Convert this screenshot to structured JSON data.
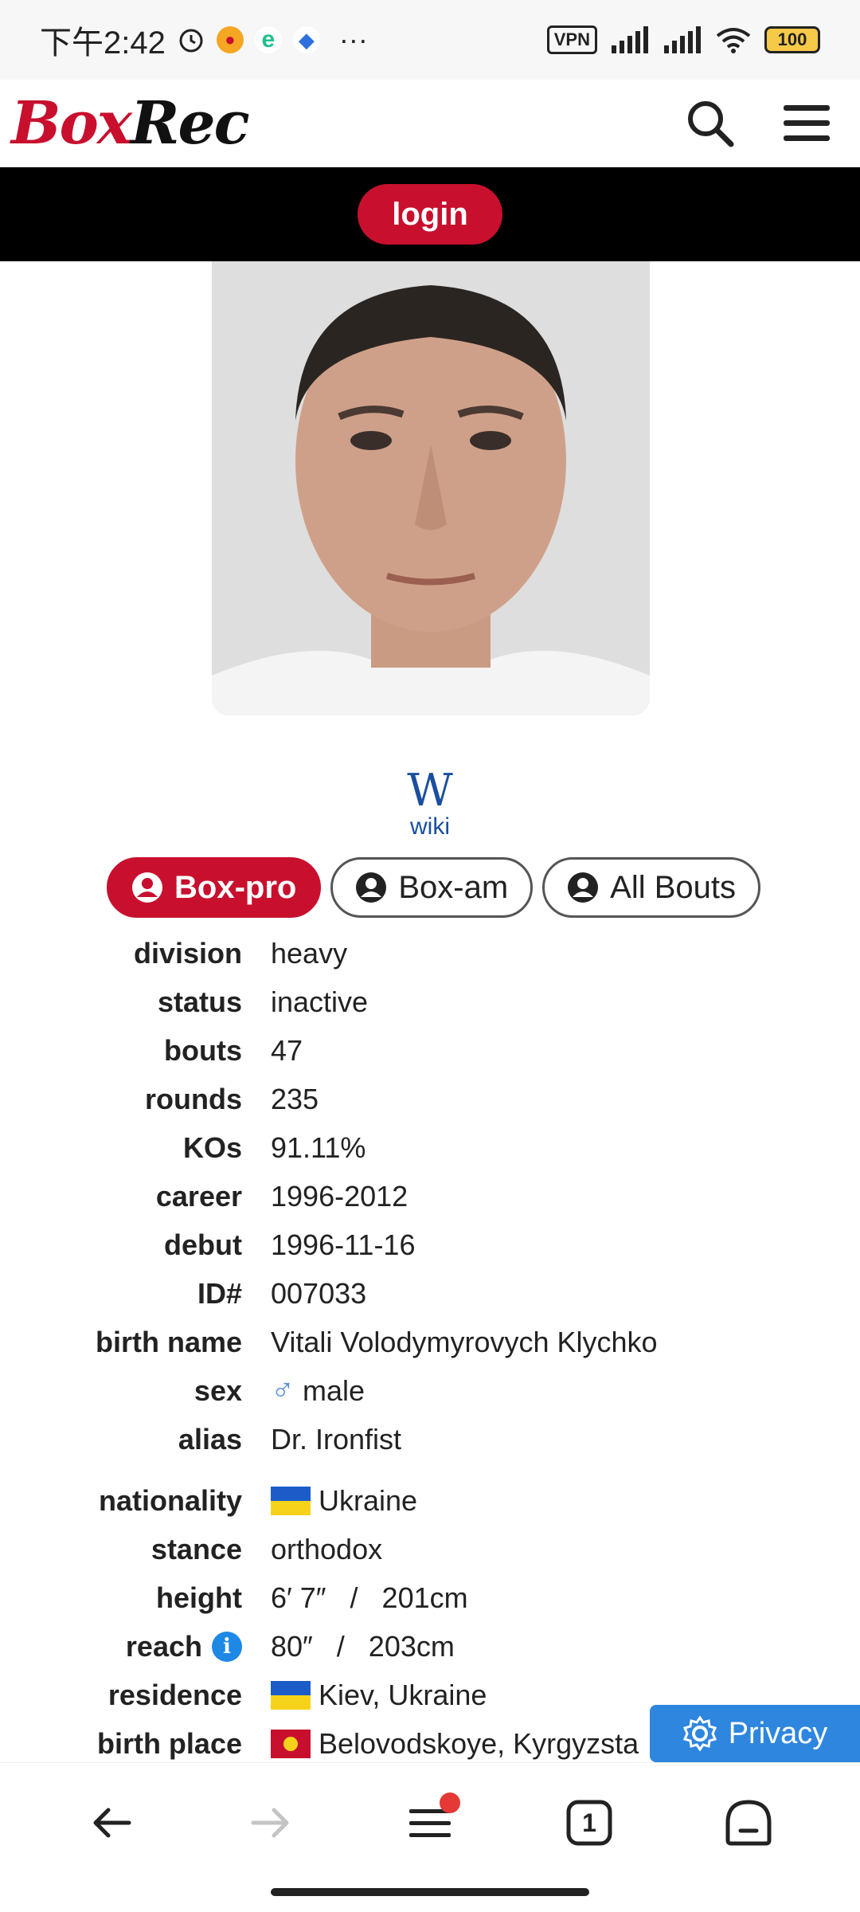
{
  "status_bar": {
    "time": "下午2:42",
    "vpn": "VPN",
    "battery": "100",
    "more": "···"
  },
  "header": {
    "logo_box": "Box",
    "logo_rec": "Rec",
    "login": "login"
  },
  "profile": {
    "wiki_label": "wiki",
    "wiki_glyph": "W"
  },
  "tabs": [
    {
      "label": "Box-pro",
      "active": true
    },
    {
      "label": "Box-am",
      "active": false
    },
    {
      "label": "All Bouts",
      "active": false
    }
  ],
  "info": {
    "division": {
      "label": "division",
      "value": "heavy"
    },
    "status": {
      "label": "status",
      "value": "inactive"
    },
    "bouts": {
      "label": "bouts",
      "value": "47"
    },
    "rounds": {
      "label": "rounds",
      "value": "235"
    },
    "kos": {
      "label": "KOs",
      "value": "91.11%"
    },
    "career": {
      "label": "career",
      "value": "1996-2012"
    },
    "debut": {
      "label": "debut",
      "value": "1996-11-16"
    },
    "id": {
      "label": "ID#",
      "value": "007033"
    },
    "birth_name": {
      "label": "birth name",
      "value": "Vitali Volodymyrovych Klychko"
    },
    "sex": {
      "label": "sex",
      "value": "male",
      "symbol": "♂"
    },
    "alias": {
      "label": "alias",
      "value": "Dr. Ironfist"
    },
    "nationality": {
      "label": "nationality",
      "value": "Ukraine"
    },
    "stance": {
      "label": "stance",
      "value": "orthodox"
    },
    "height": {
      "label": "height",
      "value": "6′ 7″   /   201cm"
    },
    "reach": {
      "label": "reach",
      "value": "80″   /   203cm",
      "info_glyph": "i"
    },
    "residence": {
      "label": "residence",
      "value": "Kiev, Ukraine"
    },
    "birth_place": {
      "label": "birth place",
      "value": "Belovodskoye, Kyrgyzsta"
    }
  },
  "privacy": {
    "label": "Privacy"
  },
  "bottom_nav": {
    "tab_count": "1"
  },
  "colors": {
    "brand_red": "#c8102e",
    "privacy_blue": "#2e86de"
  }
}
